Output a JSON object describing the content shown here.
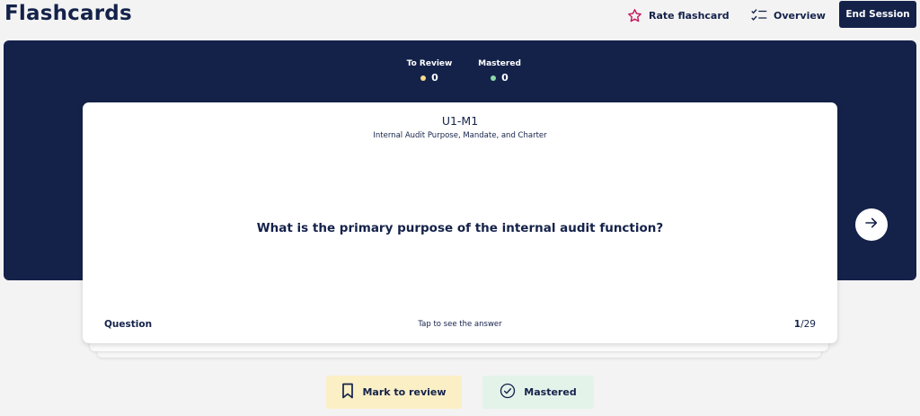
{
  "header": {
    "title": "Flashcards",
    "rate_label": "Rate flashcard",
    "overview_label": "Overview",
    "end_label": "End Session"
  },
  "stats": {
    "to_review_label": "To Review",
    "to_review_value": "0",
    "mastered_label": "Mastered",
    "mastered_value": "0",
    "to_review_color": "#f6d98b",
    "mastered_color": "#8fd9a8"
  },
  "card": {
    "code": "U1-M1",
    "topic": "Internal Audit Purpose, Mandate, and Charter",
    "question": "What is the primary purpose of the internal audit function?",
    "side_label": "Question",
    "hint": "Tap to see the answer",
    "current": "1",
    "total": "/29"
  },
  "actions": {
    "review_label": "Mark to review",
    "mastered_label": "Mastered"
  },
  "icons": {
    "rate": "star-icon",
    "overview": "checklist-icon",
    "next": "arrow-right-icon",
    "review": "bookmark-icon",
    "mastered": "check-circle-icon"
  },
  "colors": {
    "navy": "#14224a",
    "star": "#c2185b",
    "review_bg": "#fbefc6",
    "mastered_bg": "#e4f3ea"
  }
}
